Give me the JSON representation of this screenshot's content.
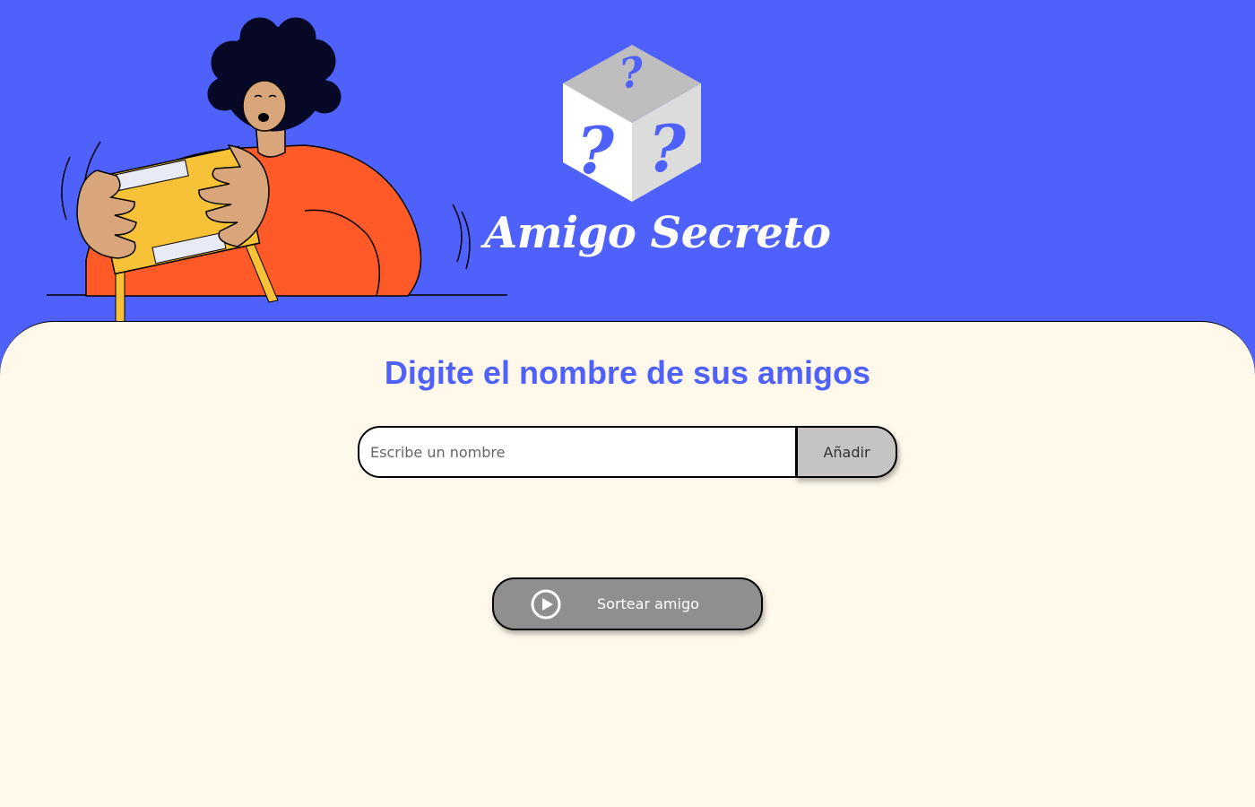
{
  "header": {
    "title": "Amigo Secreto",
    "logo_icon": "mystery-cube-icon",
    "illustration": "person-shaking-gift-box"
  },
  "main": {
    "title": "Digite el nombre de sus amigos",
    "name_input": {
      "value": "",
      "placeholder": "Escribe un nombre"
    },
    "add_button_label": "Añadir",
    "draw_button": {
      "label": "Sortear amigo",
      "icon": "play-circle-icon"
    }
  },
  "colors": {
    "header_background": "#4F61FB",
    "main_background": "#FFF8EB",
    "title_accent": "#4F61FB",
    "add_button": "#C4C4C4",
    "draw_button": "#8F8F8F"
  }
}
